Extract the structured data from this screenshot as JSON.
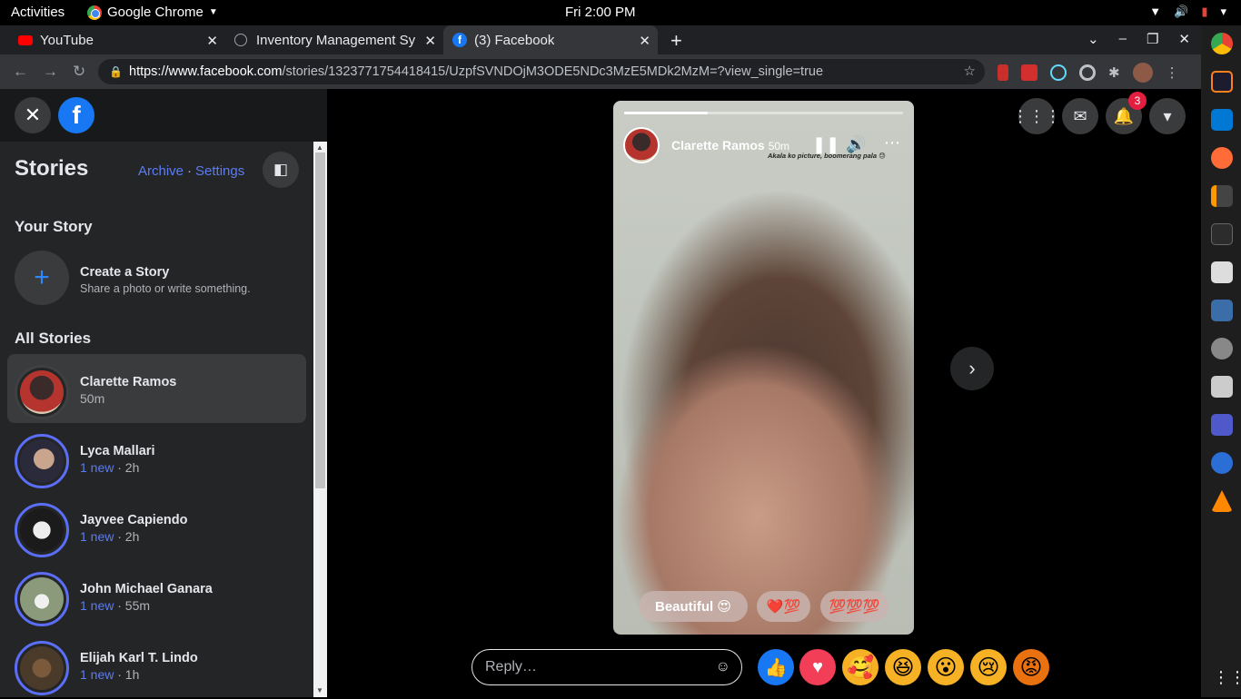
{
  "os_bar": {
    "activities": "Activities",
    "app_name": "Google Chrome",
    "clock": "Fri  2:00 PM"
  },
  "tabs": [
    {
      "title": "YouTube"
    },
    {
      "title": "Inventory Management Sy"
    },
    {
      "title": "(3) Facebook"
    }
  ],
  "address": {
    "host": "https://www.facebook.com",
    "path": "/stories/1323771754418415/UzpfSVNDOjM3ODE5NDc3MzE5MDk2MzM=?view_single=true"
  },
  "sidebar": {
    "title": "Stories",
    "archive": "Archive",
    "dot": "·",
    "settings": "Settings",
    "your_story": "Your Story",
    "create_title": "Create a Story",
    "create_sub": "Share a photo or write something.",
    "all_stories": "All Stories",
    "stories": [
      {
        "name": "Clarette Ramos",
        "new": "",
        "time": "50m",
        "avatar_color": "#b5352e"
      },
      {
        "name": "Lyca Mallari",
        "new": "1 new",
        "time": " · 2h",
        "avatar_color": "#2a2a3a"
      },
      {
        "name": "Jayvee Capiendo",
        "new": "1 new",
        "time": " · 2h",
        "avatar_color": "#1b1b1b"
      },
      {
        "name": "John Michael Ganara",
        "new": "1 new",
        "time": " · 55m",
        "avatar_color": "#8a9a7a"
      },
      {
        "name": "Elijah Karl T. Lindo",
        "new": "1 new",
        "time": " · 1h",
        "avatar_color": "#4a3a2a"
      }
    ]
  },
  "viewer": {
    "name": "Clarette Ramos",
    "time": "50m",
    "caption": "Akala ko picture, boomerang pala 😓",
    "progress": 0.3,
    "chips": [
      "Beautiful 😍",
      "❤️💯",
      "💯💯💯"
    ],
    "reply_placeholder": "Reply…"
  },
  "header": {
    "notifications": "3"
  },
  "reactions": [
    "like",
    "love",
    "care",
    "haha",
    "wow",
    "sad",
    "angry"
  ]
}
